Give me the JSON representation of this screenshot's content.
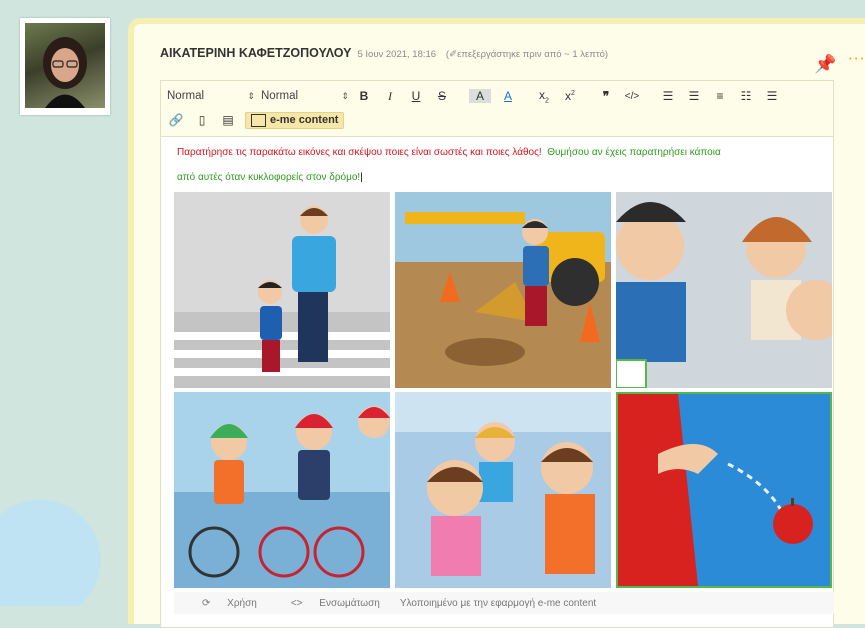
{
  "post": {
    "author": "ΑΙΚΑΤΕΡΙΝΗ ΚΑΦΕΤΖΟΠΟΥΛΟΥ",
    "date": "5 Ιουν 2021, 18:16",
    "edited": "επεξεργάστηκε πριν από ~ 1 λεπτό"
  },
  "toolbar": {
    "font_select": "Normal",
    "size_select": "Normal",
    "eme_label": "e-me content"
  },
  "content": {
    "red_text": "Παρατήρησε τις παρακάτω εικόνες και σκέψου ποιες είναι σωστές και ποιες λάθος!",
    "green_text_1": "Θυμήσου αν έχεις παρατηρήσει κάποια",
    "green_text_2": "από αυτές όταν κυκλοφορείς στον δρόμο!"
  },
  "footer": {
    "use": "Χρήση",
    "embed": "Ενσωμάτωση",
    "credit": "Υλοποιημένο με την εφαρμογή e-me content"
  },
  "colors": {
    "accent": "#f0b400",
    "red": "#d8131b",
    "green": "#2e9b1c"
  },
  "icons": [
    "pin-icon",
    "more-icon",
    "link-icon",
    "file-icon",
    "film-icon",
    "e-me-content-icon",
    "reuse-icon",
    "embed-icon"
  ]
}
